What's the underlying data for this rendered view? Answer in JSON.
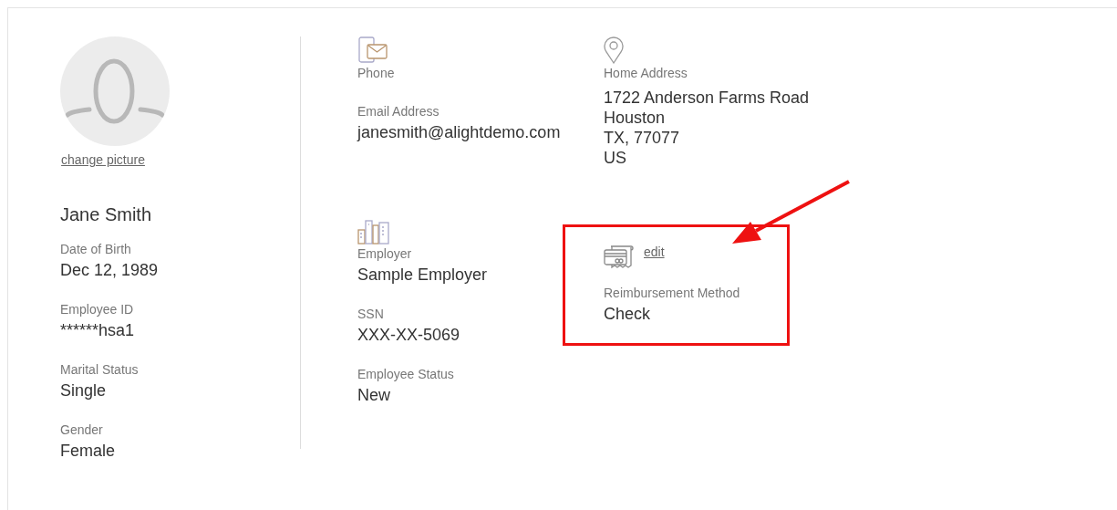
{
  "profile": {
    "change_picture": "change picture",
    "name": "Jane Smith",
    "fields": [
      {
        "label": "Date of Birth",
        "value": "Dec 12, 1989"
      },
      {
        "label": "Employee ID",
        "value": "******hsa1"
      },
      {
        "label": "Marital Status",
        "value": "Single"
      },
      {
        "label": "Gender",
        "value": "Female"
      }
    ]
  },
  "contact": {
    "phone_label": "Phone",
    "email_label": "Email Address",
    "email": "janesmith@alightdemo.com"
  },
  "address": {
    "label": "Home Address",
    "lines": [
      "1722 Anderson Farms Road",
      "Houston",
      "TX, 77077",
      "US"
    ]
  },
  "employment": {
    "fields": [
      {
        "label": "Employer",
        "value": "Sample Employer"
      },
      {
        "label": "SSN",
        "value": "XXX-XX-5069"
      },
      {
        "label": "Employee Status",
        "value": "New"
      }
    ]
  },
  "reimbursement": {
    "edit": "edit",
    "label": "Reimbursement Method",
    "value": "Check",
    "highlighted": true
  }
}
